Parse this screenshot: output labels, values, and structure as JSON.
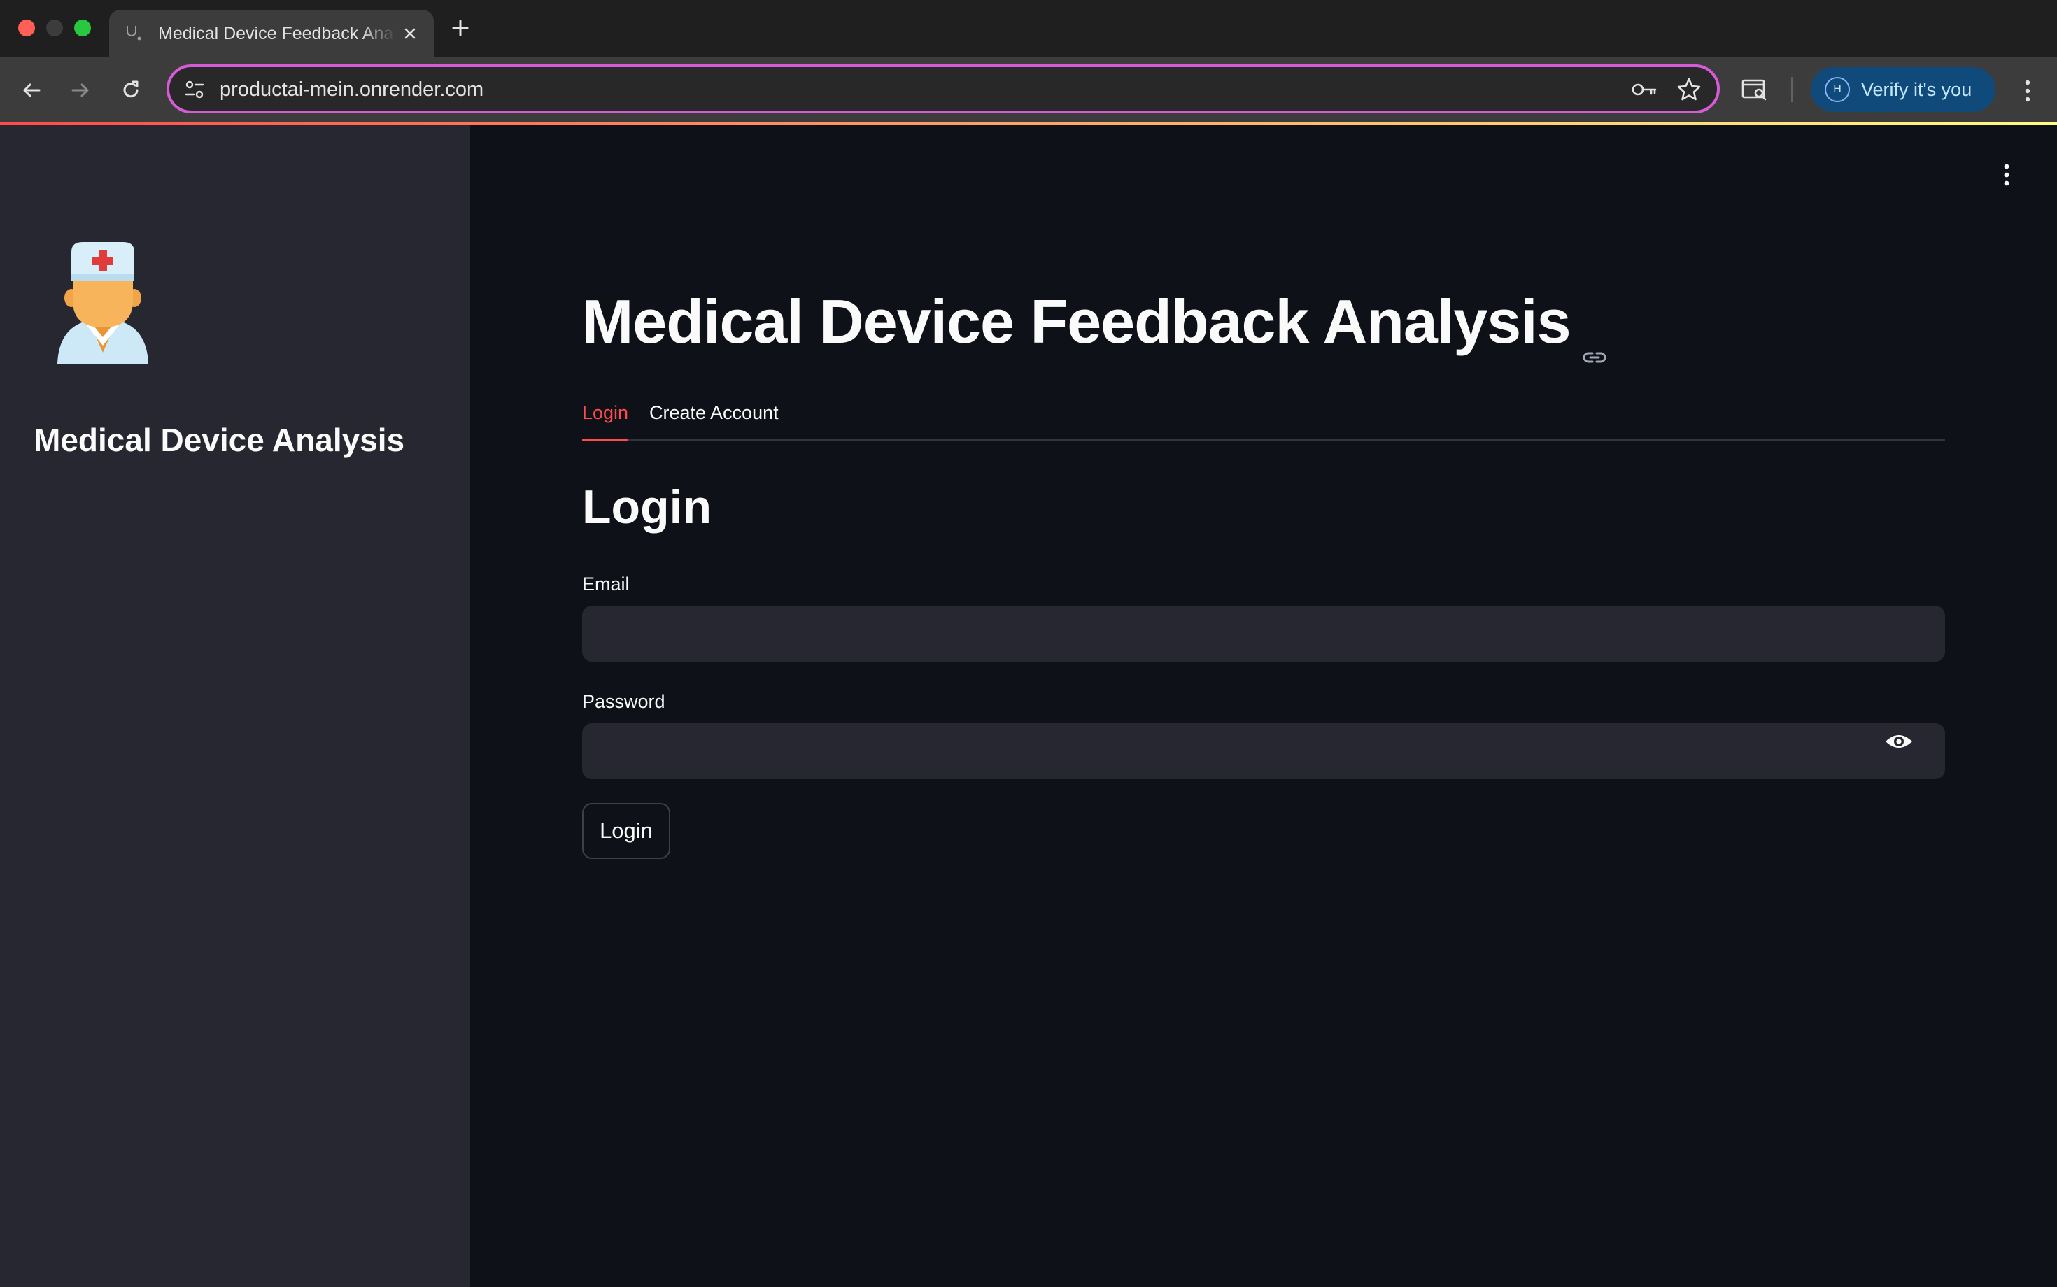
{
  "browser": {
    "tab_title": "Medical Device Feedback Analysis",
    "url": "productai-mein.onrender.com",
    "profile_initial": "H",
    "profile_label": "Verify it's you"
  },
  "sidebar": {
    "logo_icon": "doctor-icon",
    "title": "Medical Device Analysis"
  },
  "main": {
    "title": "Medical Device Feedback Analysis",
    "tabs": [
      {
        "label": "Login",
        "active": true
      },
      {
        "label": "Create Account",
        "active": false
      }
    ],
    "section_title": "Login",
    "email": {
      "label": "Email",
      "value": ""
    },
    "password": {
      "label": "Password",
      "value": ""
    },
    "submit_label": "Login"
  },
  "colors": {
    "accent": "#ff4b4b",
    "background": "#0e1117",
    "sidebar_bg": "#262730",
    "omnibox_outline": "#d65bd6"
  }
}
